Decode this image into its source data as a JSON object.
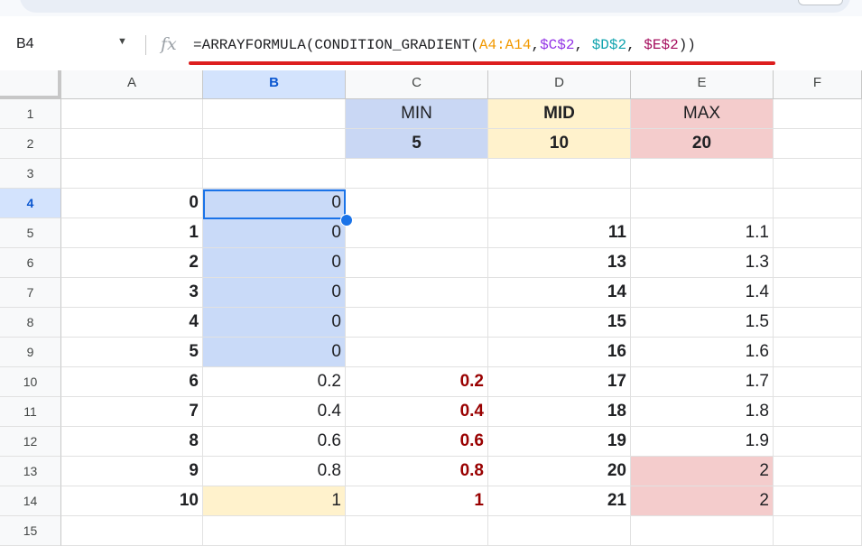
{
  "formula_bar": {
    "name_box": "B4",
    "fx_label": "fx",
    "formula_parts": [
      {
        "text": "=ARRAYFORMULA(CONDITION_GRADIENT(",
        "color": "#202124"
      },
      {
        "text": "A4:A14",
        "color": "#f29900"
      },
      {
        "text": ",",
        "color": "#202124"
      },
      {
        "text": "$C$2",
        "color": "#9334e6"
      },
      {
        "text": ", ",
        "color": "#202124"
      },
      {
        "text": "$D$2",
        "color": "#12a4af"
      },
      {
        "text": ", ",
        "color": "#202124"
      },
      {
        "text": "$E$2",
        "color": "#a50e5e"
      },
      {
        "text": "))",
        "color": "#202124"
      }
    ]
  },
  "columns": [
    "A",
    "B",
    "C",
    "D",
    "E",
    "F"
  ],
  "selected_column": "B",
  "rows": [
    "1",
    "2",
    "3",
    "4",
    "5",
    "6",
    "7",
    "8",
    "9",
    "10",
    "11",
    "12",
    "13",
    "14",
    "15"
  ],
  "selected_row": "4",
  "colors": {
    "min_fill": "#c9d7f4",
    "mid_fill": "#fff2cc",
    "max_fill": "#f4cccc",
    "selection_fill": "#c9daf8",
    "selection_border": "#1a73e8",
    "highlight_red": "#990000",
    "annotation_underline": "#dd1e1e"
  },
  "cells": {
    "C1": "MIN",
    "D1": "MID",
    "E1": "MAX",
    "C2": "5",
    "D2": "10",
    "E2": "20",
    "A4": "0",
    "B4": "0",
    "A5": "1",
    "B5": "0",
    "D5": "11",
    "E5": "1.1",
    "A6": "2",
    "B6": "0",
    "D6": "13",
    "E6": "1.3",
    "A7": "3",
    "B7": "0",
    "D7": "14",
    "E7": "1.4",
    "A8": "4",
    "B8": "0",
    "D8": "15",
    "E8": "1.5",
    "A9": "5",
    "B9": "0",
    "D9": "16",
    "E9": "1.6",
    "A10": "6",
    "B10": "0.2",
    "C10": "0.2",
    "D10": "17",
    "E10": "1.7",
    "A11": "7",
    "B11": "0.4",
    "C11": "0.4",
    "D11": "18",
    "E11": "1.8",
    "A12": "8",
    "B12": "0.6",
    "C12": "0.6",
    "D12": "19",
    "E12": "1.9",
    "A13": "9",
    "B13": "0.8",
    "C13": "0.8",
    "D13": "20",
    "E13": "2",
    "A14": "10",
    "B14": "1",
    "C14": "1",
    "D14": "21",
    "E14": "2"
  }
}
